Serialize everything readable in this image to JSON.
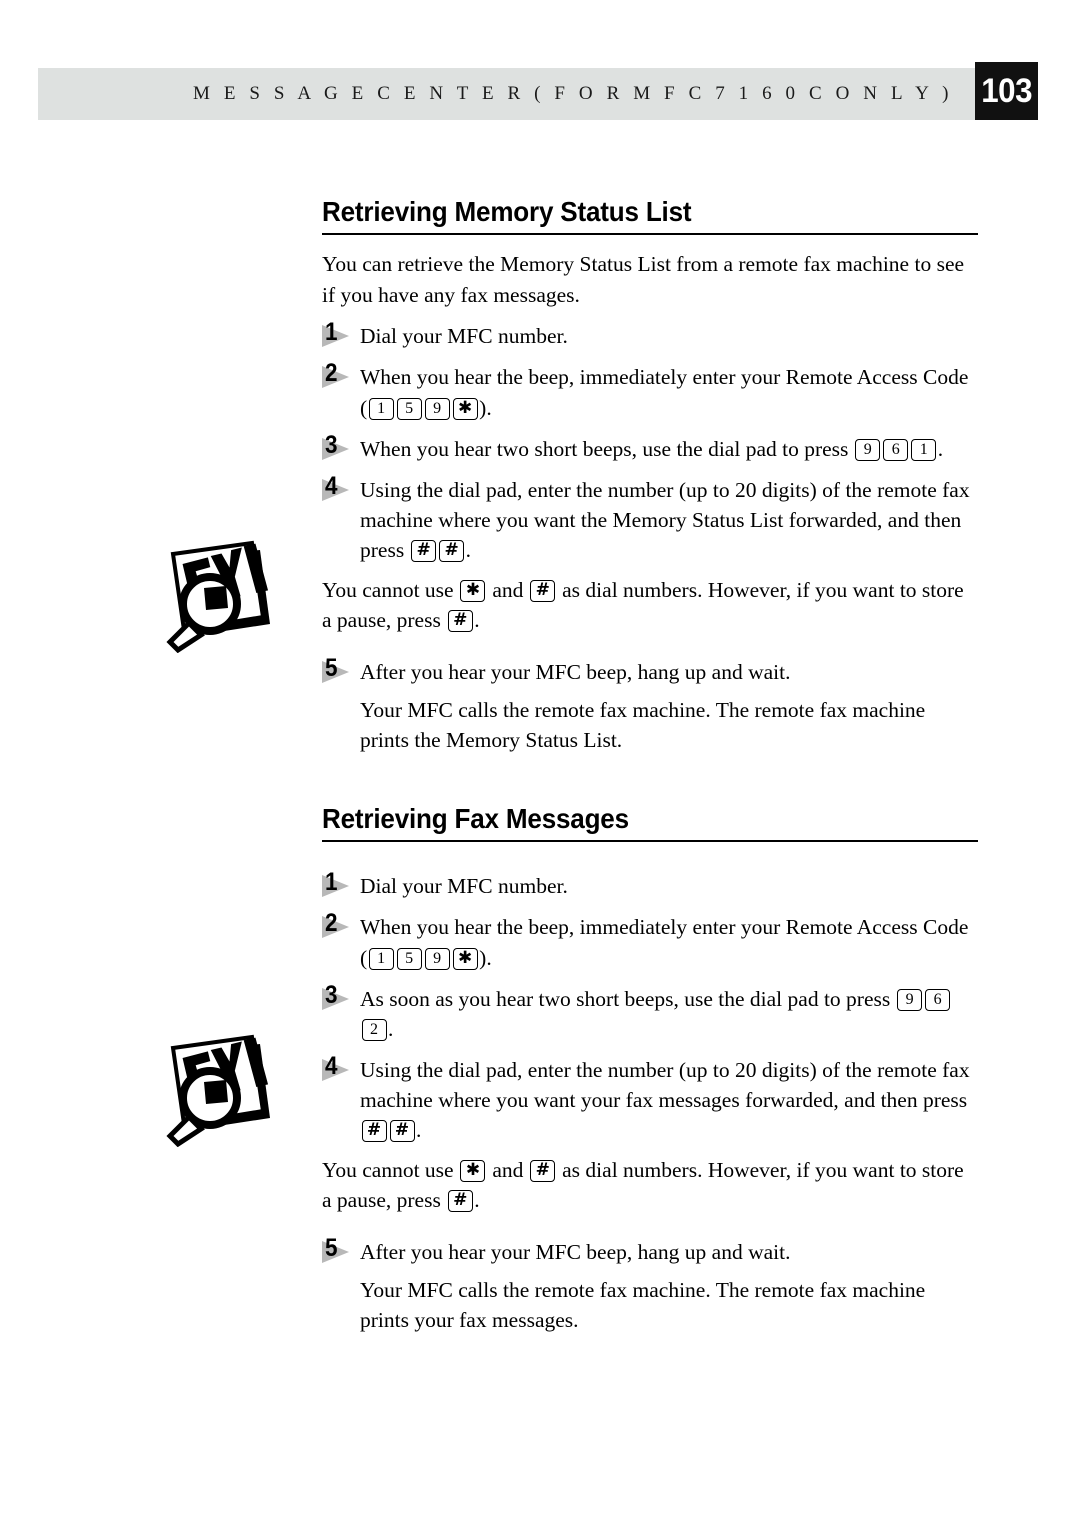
{
  "header": {
    "running_title": "M E S S A G E   C E N T E R   ( F O R   M F C   7 1 6 0 C   O N L Y )",
    "page_number": "103",
    "band_color": "#dee1e0",
    "page_box_color": "#111111"
  },
  "sections": [
    {
      "id": "retrieving-memory-status-list",
      "heading": "Retrieving Memory Status List",
      "intro": "You can retrieve the Memory Status List from a remote fax machine to see if you have any fax messages.",
      "steps": [
        {
          "number": "1",
          "parts": [
            {
              "kind": "text",
              "value": "Dial your MFC number."
            }
          ]
        },
        {
          "number": "2",
          "parts": [
            {
              "kind": "text",
              "value": "When you hear the beep, immediately enter your Remote Access Code ("
            },
            {
              "kind": "key",
              "value": "1"
            },
            {
              "kind": "key",
              "value": "5"
            },
            {
              "kind": "key",
              "value": "9"
            },
            {
              "kind": "key",
              "value": "✱",
              "symbol": "star"
            },
            {
              "kind": "text",
              "value": ")."
            }
          ]
        },
        {
          "number": "3",
          "parts": [
            {
              "kind": "text",
              "value": "When you hear two short beeps, use the dial pad to press "
            },
            {
              "kind": "key",
              "value": "9"
            },
            {
              "kind": "key",
              "value": "6"
            },
            {
              "kind": "key",
              "value": "1"
            },
            {
              "kind": "text",
              "value": "."
            }
          ]
        },
        {
          "number": "4",
          "parts": [
            {
              "kind": "text",
              "value": "Using the dial pad, enter the number (up to 20 digits) of the remote fax machine where you want the Memory Status List forwarded, and then press "
            },
            {
              "kind": "key",
              "value": "#",
              "symbol": "hash"
            },
            {
              "kind": "key",
              "value": "#",
              "symbol": "hash"
            },
            {
              "kind": "text",
              "value": "."
            }
          ]
        }
      ],
      "note": {
        "icon": "fyi-icon",
        "parts": [
          {
            "kind": "text",
            "value": "You cannot use "
          },
          {
            "kind": "key",
            "value": "✱",
            "symbol": "star"
          },
          {
            "kind": "text",
            "value": " and "
          },
          {
            "kind": "key",
            "value": "#",
            "symbol": "hash"
          },
          {
            "kind": "text",
            "value": " as dial numbers. However, if you want to store a pause, press "
          },
          {
            "kind": "key",
            "value": "#",
            "symbol": "hash"
          },
          {
            "kind": "text",
            "value": "."
          }
        ]
      },
      "steps_after_note": [
        {
          "number": "5",
          "parts": [
            {
              "kind": "text",
              "value": "After you hear your MFC beep, hang up and wait."
            }
          ]
        }
      ],
      "closing": "Your MFC calls the remote fax machine. The remote fax machine prints the Memory Status List."
    },
    {
      "id": "retrieving-fax-messages",
      "heading": "Retrieving Fax Messages",
      "intro": "",
      "steps": [
        {
          "number": "1",
          "parts": [
            {
              "kind": "text",
              "value": "Dial your MFC number."
            }
          ]
        },
        {
          "number": "2",
          "parts": [
            {
              "kind": "text",
              "value": "When you hear the beep, immediately enter your Remote Access Code ("
            },
            {
              "kind": "key",
              "value": "1"
            },
            {
              "kind": "key",
              "value": "5"
            },
            {
              "kind": "key",
              "value": "9"
            },
            {
              "kind": "key",
              "value": "✱",
              "symbol": "star"
            },
            {
              "kind": "text",
              "value": ")."
            }
          ]
        },
        {
          "number": "3",
          "parts": [
            {
              "kind": "text",
              "value": "As soon as you hear two short beeps, use the dial pad to press "
            },
            {
              "kind": "key",
              "value": "9"
            },
            {
              "kind": "key",
              "value": "6"
            },
            {
              "kind": "key",
              "value": "2"
            },
            {
              "kind": "text",
              "value": "."
            }
          ]
        },
        {
          "number": "4",
          "parts": [
            {
              "kind": "text",
              "value": "Using the dial pad, enter the number (up to 20 digits) of the remote fax machine where you want your fax messages forwarded, and then press "
            },
            {
              "kind": "key",
              "value": "#",
              "symbol": "hash"
            },
            {
              "kind": "key",
              "value": "#",
              "symbol": "hash"
            },
            {
              "kind": "text",
              "value": "."
            }
          ]
        }
      ],
      "note": {
        "icon": "fyi-icon",
        "parts": [
          {
            "kind": "text",
            "value": "You cannot use "
          },
          {
            "kind": "key",
            "value": "✱",
            "symbol": "star"
          },
          {
            "kind": "text",
            "value": " and "
          },
          {
            "kind": "key",
            "value": "#",
            "symbol": "hash"
          },
          {
            "kind": "text",
            "value": " as dial numbers.  However, if you want to store a pause, press "
          },
          {
            "kind": "key",
            "value": "#",
            "symbol": "hash"
          },
          {
            "kind": "text",
            "value": "."
          }
        ]
      },
      "steps_after_note": [
        {
          "number": "5",
          "parts": [
            {
              "kind": "text",
              "value": "After you hear your MFC beep, hang up and wait."
            }
          ]
        }
      ],
      "closing": "Your MFC calls the remote fax machine. The remote fax machine prints your fax messages."
    }
  ],
  "margin_icons": [
    {
      "name": "fyi-icon",
      "label": "FYI"
    },
    {
      "name": "fyi-icon",
      "label": "FYI"
    }
  ]
}
